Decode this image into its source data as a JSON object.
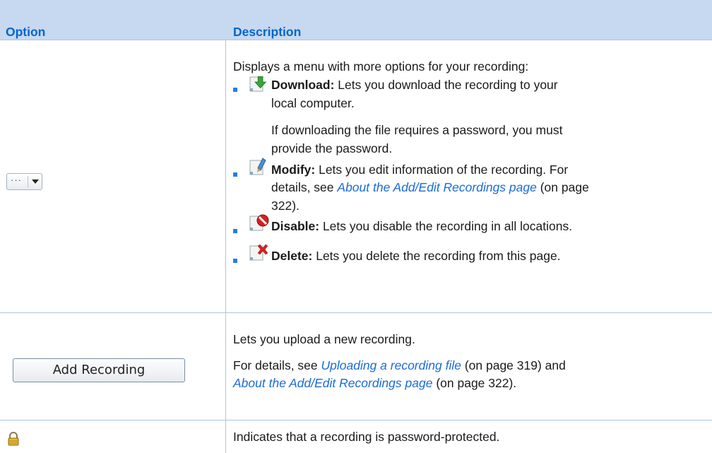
{
  "header": {
    "option": "Option",
    "description": "Description"
  },
  "rows": [
    {
      "intro": "Displays a menu with more options for your recording:",
      "items": [
        {
          "label": "Download:",
          "line1": " Lets you download the recording to your",
          "line2": "local computer.",
          "note1": "If downloading the file requires a password, you must",
          "note2": "provide the password."
        },
        {
          "label": "Modify:",
          "line1": " Lets you edit information of the recording. For",
          "line2_pre": "details, see ",
          "line2_link": "About the Add/Edit Recordings page",
          "line2_post": " (on page",
          "line3": "322)."
        },
        {
          "label": "Disable:",
          "line1": " Lets you disable the recording in all locations."
        },
        {
          "label": "Delete:",
          "line1": " Lets you delete the recording from this page."
        }
      ]
    },
    {
      "button_label": "Add Recording",
      "intro": "Lets you upload a new recording.",
      "line1_pre": "For details, see ",
      "line1_link": "Uploading a recording file",
      "line1_post": " (on page 319) and",
      "line2_link": "About the Add/Edit Recordings page",
      "line2_post": " (on page 322)."
    },
    {
      "text": "Indicates that a recording is password-protected."
    }
  ],
  "icons": {
    "more": "split-menu-button",
    "download": "download-icon",
    "modify": "modify-icon",
    "disable": "disable-icon",
    "delete": "delete-icon",
    "lock": "lock-icon"
  }
}
